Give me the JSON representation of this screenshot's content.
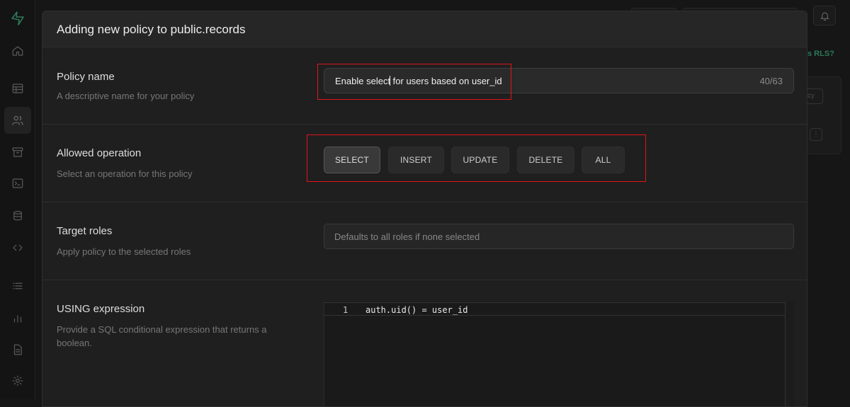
{
  "modal": {
    "title": "Adding new policy to public.records"
  },
  "policy_name": {
    "label": "Policy name",
    "description": "A descriptive name for your policy",
    "value_before_caret": "Enable select",
    "value_after_caret": " for users based on user_id",
    "char_count": "40/63"
  },
  "allowed_operation": {
    "label": "Allowed operation",
    "description": "Select an operation for this policy",
    "options": [
      "SELECT",
      "INSERT",
      "UPDATE",
      "DELETE",
      "ALL"
    ],
    "selected": "SELECT"
  },
  "target_roles": {
    "label": "Target roles",
    "description": "Apply policy to the selected roles",
    "placeholder": "Defaults to all roles if none selected"
  },
  "using_expression": {
    "label": "USING expression",
    "description": "Provide a SQL conditional expression that returns a boolean.",
    "lines": [
      {
        "num": "1",
        "code": "auth.uid() = user_id"
      }
    ]
  },
  "background": {
    "link_fragment": "s RLS?",
    "chip_fragment": "cy",
    "dots": "⋮"
  },
  "colors": {
    "highlight": "#e0141b",
    "accent": "#3ecf8e"
  },
  "icons": [
    "supabase-logo-icon",
    "home-icon",
    "table-editor-icon",
    "auth-users-icon",
    "storage-icon",
    "sql-terminal-icon",
    "database-icon",
    "api-code-icon",
    "list-icon",
    "reports-icon",
    "docs-icon",
    "settings-icon",
    "bell-icon"
  ]
}
